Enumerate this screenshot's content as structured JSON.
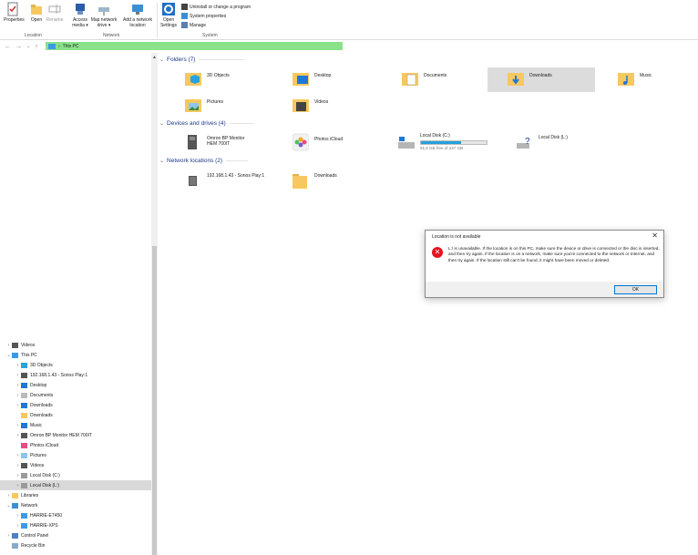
{
  "ribbon": {
    "properties": "Properties",
    "open": "Open",
    "rename": "Rename",
    "access_media": "Access media ▾",
    "map_network_drive": "Map network drive ▾",
    "add_network_location": "Add a network location",
    "open_settings": "Open Settings",
    "uninstall": "Uninstall or change a program",
    "system_properties": "System properties",
    "manage": "Manage",
    "group_location": "Location",
    "group_network": "Network",
    "group_system": "System"
  },
  "address": {
    "path": "This PC",
    "separator": "›"
  },
  "nav": {
    "items": [
      {
        "label": "Videos",
        "chev": "›",
        "icon": "video-icon"
      },
      {
        "label": "This PC",
        "chev": "⌄",
        "icon": "pc-icon"
      },
      {
        "label": "3D Objects",
        "chev": "›",
        "icon": "cube-icon"
      },
      {
        "label": "192.168.1.43 - Sonos Play:1",
        "chev": "›",
        "icon": "device-icon"
      },
      {
        "label": "Desktop",
        "chev": "›",
        "icon": "desktop-icon"
      },
      {
        "label": "Documents",
        "chev": "›",
        "icon": "document-icon"
      },
      {
        "label": "Downloads",
        "chev": "›",
        "icon": "download-icon"
      },
      {
        "label": "Downloads",
        "chev": "",
        "icon": "folder-icon"
      },
      {
        "label": "Music",
        "chev": "›",
        "icon": "music-icon"
      },
      {
        "label": "Omron BP Monitor HEM 700IT",
        "chev": "›",
        "icon": "device-icon"
      },
      {
        "label": "Photos iCloud",
        "chev": "",
        "icon": "photos-icon"
      },
      {
        "label": "Pictures",
        "chev": "›",
        "icon": "picture-icon"
      },
      {
        "label": "Videos",
        "chev": "›",
        "icon": "video-icon"
      },
      {
        "label": "Local Disk (C:)",
        "chev": "›",
        "icon": "drive-icon"
      },
      {
        "label": "Local Disk (L:)",
        "chev": "›",
        "icon": "drive-icon"
      },
      {
        "label": "Libraries",
        "chev": "›",
        "icon": "library-icon"
      },
      {
        "label": "Network",
        "chev": "⌄",
        "icon": "network-icon"
      },
      {
        "label": "HARRIE-E7450",
        "chev": "›",
        "icon": "computer-icon"
      },
      {
        "label": "HARRIE-XPS",
        "chev": "›",
        "icon": "computer-icon"
      },
      {
        "label": "Control Panel",
        "chev": "›",
        "icon": "control-panel-icon"
      },
      {
        "label": "Recycle Bin",
        "chev": "",
        "icon": "recycle-bin-icon"
      }
    ]
  },
  "content": {
    "folders_header": "Folders (7)",
    "folders": [
      "3D Objects",
      "Desktop",
      "Documents",
      "Downloads",
      "Music",
      "Pictures",
      "Videos"
    ],
    "devices_header": "Devices and drives (4)",
    "devices": {
      "omron_line1": "Omron BP Monitor",
      "omron_line2": "HEM 700IT",
      "photos": "Photos iCloud",
      "c_label": "Local Disk (C:)",
      "c_free": "91,5 GB free of 237 GB",
      "c_used_fraction": 0.61,
      "l_label": "Local Disk (L:)"
    },
    "network_header": "Network locations (2)",
    "network": [
      "192.168.1.43 - Sonos Play:1",
      "Downloads"
    ]
  },
  "dialog": {
    "title": "Location is not available",
    "close": "✕",
    "icon": "✕",
    "message": "L:\\ is unavailable. If the location is on this PC, make sure the device or drive is connected or the disc is inserted, and then try again. If the location is on a network, make sure you're connected to the network or Internet, and then try again. If the location still can't be found, it might have been moved or deleted.",
    "ok": "OK"
  }
}
